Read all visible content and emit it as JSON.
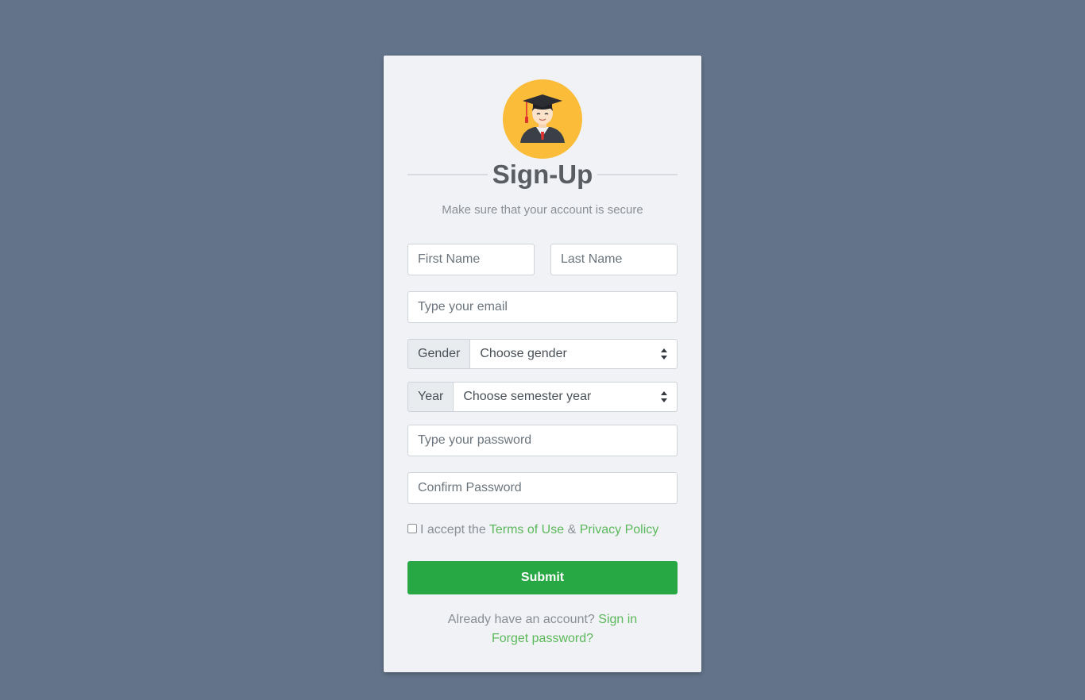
{
  "header": {
    "title": "Sign-Up",
    "subtitle": "Make sure that your account is secure",
    "avatar_icon": "graduate-avatar-icon"
  },
  "form": {
    "first_name_placeholder": "First Name",
    "last_name_placeholder": "Last Name",
    "email_placeholder": "Type your email",
    "gender_label": "Gender",
    "gender_selected": "Choose gender",
    "year_label": "Year",
    "year_selected": "Choose semester year",
    "password_placeholder": "Type your password",
    "confirm_password_placeholder": "Confirm Password",
    "terms_prefix": "I accept the",
    "terms_link": "Terms of Use",
    "terms_amp": "&",
    "privacy_link": "Privacy Policy",
    "submit_label": "Submit"
  },
  "footer": {
    "account_prompt": "Already have an account?",
    "sign_in_link": "Sign in",
    "forget_password_link": "Forget password?"
  },
  "colors": {
    "background": "#637389",
    "card": "#f0f2f5",
    "accent": "#28a745",
    "link": "#5cb85c",
    "avatar_bg": "#fbbc3a"
  }
}
